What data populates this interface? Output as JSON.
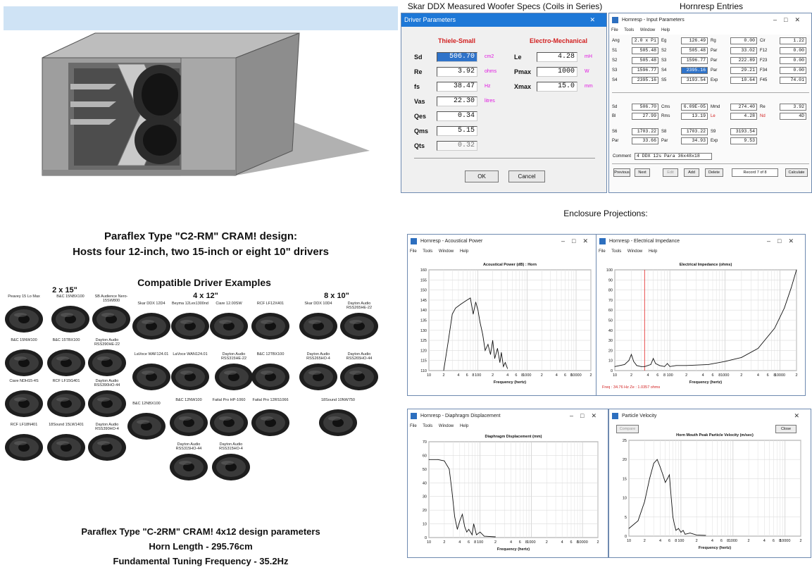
{
  "catalog": {
    "caption_line1": "Paraflex Type \"C2-RM\" CRAM! design:",
    "caption_line2": "Hosts four 12-inch, two 15-inch or eight 10\" drivers",
    "drivers_title": "Compatible Driver Examples",
    "groups": {
      "g15": "2 x 15\"",
      "g12": "4 x 12\"",
      "g10": "8 x 10\""
    },
    "drivers": [
      "Peavey 15 Lo Max",
      "B&C 15NBX100",
      "SB Audience Nero-15SW800",
      "B&C 15NW100",
      "B&C 15TBX100",
      "Dayton Audio RSS390HE-22",
      "Ciare NDH15-4S",
      "RCF LF15G401",
      "Dayton Audio RSS390HO-44",
      "RCF LF18N401",
      "18Sound 15LW1401",
      "Dayton Audio RSS390HO-4",
      "Skar DDX 12D4",
      "Beyma 12Lex1300nd",
      "Ciare 12.00SW",
      "RCF LF12X401",
      "LaVoce WAF124.01",
      "LaVoce WAN124.01",
      "Dayton Audio RSS315HE-22",
      "B&C 12TBX100",
      "B&C 12NBX100",
      "B&C 12NW100",
      "Faital Pro HP-1060",
      "Faital Pro 12RS1066",
      "Dayton Audio RSS315HO-44",
      "Dayton Audio RSS315HO-4",
      "Skar DDX 10D4",
      "Dayton Audio RSS265HE-22",
      "Dayton Audio RSS265HO-4",
      "Dayton Audio RSS265HO-44",
      "18Sound 10NW750"
    ],
    "params_line1": "Paraflex Type \"C-2RM\" CRAM! 4x12 design parameters",
    "params_line2": "Horn Length - 295.76cm",
    "params_line3": "Fundamental Tuning Frequency - 35.2Hz"
  },
  "driver_dialog": {
    "heading": "Skar DDX Measured Woofer Specs (Coils in Series)",
    "title": "Driver Parameters",
    "section_ts": "Thiele-Small",
    "section_em": "Electro-Mechanical",
    "ts": [
      {
        "label": "Sd",
        "value": "506.70",
        "unit": "cm2"
      },
      {
        "label": "Re",
        "value": "3.92",
        "unit": "ohms"
      },
      {
        "label": "fs",
        "value": "38.47",
        "unit": "Hz"
      },
      {
        "label": "Vas",
        "value": "22.30",
        "unit": "litres"
      },
      {
        "label": "Qes",
        "value": "0.34",
        "unit": ""
      },
      {
        "label": "Qms",
        "value": "5.15",
        "unit": ""
      },
      {
        "label": "Qts",
        "value": "0.32",
        "unit": ""
      }
    ],
    "em": [
      {
        "label": "Le",
        "value": "4.28",
        "unit": "mH"
      },
      {
        "label": "Pmax",
        "value": "1000",
        "unit": "W"
      },
      {
        "label": "Xmax",
        "value": "15.0",
        "unit": "mm"
      }
    ],
    "ok": "OK",
    "cancel": "Cancel"
  },
  "hornresp": {
    "heading": "Hornresp Entries",
    "title": "Hornresp - Input Parameters",
    "menu": [
      "File",
      "Tools",
      "Window",
      "Help"
    ],
    "rows1": [
      [
        [
          "Ang",
          "2.0 x Pi"
        ],
        [
          "Eg",
          "126.49"
        ],
        [
          "Rg",
          "0.00"
        ],
        [
          "Cir",
          "1.22"
        ]
      ],
      [
        [
          "S1",
          "505.48"
        ],
        [
          "S2",
          "505.48"
        ],
        [
          "Par",
          "33.02"
        ],
        [
          "F12",
          "0.00"
        ]
      ],
      [
        [
          "S2",
          "505.48"
        ],
        [
          "S3",
          "1596.77"
        ],
        [
          "Par",
          "222.89"
        ],
        [
          "F23",
          "0.00"
        ]
      ],
      [
        [
          "S3",
          "1596.77"
        ],
        [
          "S4",
          "2395.16"
        ],
        [
          "Par",
          "29.21"
        ],
        [
          "F34",
          "0.00"
        ]
      ],
      [
        [
          "S4",
          "2395.16"
        ],
        [
          "S5",
          "3193.54"
        ],
        [
          "Exp",
          "10.64"
        ],
        [
          "F45",
          "74.01"
        ]
      ]
    ],
    "rows2": [
      [
        [
          "Sd",
          "506.70"
        ],
        [
          "Cms",
          "6.09E-05"
        ],
        [
          "Mmd",
          "274.40"
        ],
        [
          "Re",
          "3.92"
        ]
      ],
      [
        [
          "Bl",
          "27.99"
        ],
        [
          "Rms",
          "13.19"
        ],
        [
          "Le",
          "4.28"
        ],
        [
          "Nd",
          "4D"
        ]
      ],
      [
        [
          "S6",
          "1703.22"
        ],
        [
          "S8",
          "1703.22"
        ],
        [
          "S9",
          "3193.54"
        ]
      ],
      [
        [
          "Par",
          "33.66"
        ],
        [
          "Par",
          "34.93"
        ],
        [
          "Exp",
          "9.53"
        ]
      ]
    ],
    "comment_label": "Comment",
    "comment": "4 DDX 12s Para 36x48x18",
    "buttons": [
      "Previous",
      "Next",
      "Edit",
      "Add",
      "Delete",
      "Record 7 of 8",
      "Calculate"
    ]
  },
  "projections": {
    "heading": "Enclosure Projections:",
    "power": {
      "window": "Hornresp - Acoustical Power",
      "title": "Acoustical Power (dB) : Horn",
      "xlabel": "Frequency (hertz)"
    },
    "impedance": {
      "window": "Hornresp - Electrical Impedance",
      "title": "Electrical Impedance (ohms)",
      "xlabel": "Frequency (hertz)",
      "readout": "Freq : 34.76 Hz   Ze : 1.0357 ohms",
      "marker_hz": 34.76
    },
    "displacement": {
      "window": "Hornresp - Diaphragm Displacement",
      "title": "Diaphragm Displacement (mm)",
      "xlabel": "Frequency (hertz)"
    },
    "velocity": {
      "window": "Particle Velocity",
      "title": "Horn Mouth Peak Particle Velocity (m/sec)",
      "xlabel": "Frequency (hertz)",
      "compare": "Compare",
      "close": "Close"
    },
    "menu": [
      "File",
      "Tools",
      "Window",
      "Help"
    ]
  },
  "chart_data": [
    {
      "type": "line",
      "title": "Acoustical Power (dB) : Horn",
      "xlabel": "Frequency (hertz)",
      "xscale": "log",
      "xlim": [
        10,
        20000
      ],
      "ylim": [
        110,
        160
      ],
      "yticks": [
        110,
        115,
        120,
        125,
        130,
        135,
        140,
        145,
        150,
        155,
        160
      ],
      "xticks": [
        "10",
        "2",
        "4",
        "6",
        "8",
        "100",
        "2",
        "4",
        "6",
        "8",
        "1000",
        "2",
        "4",
        "6",
        "8",
        "10000",
        "2"
      ],
      "x": [
        20,
        25,
        30,
        35,
        45,
        60,
        70,
        80,
        90,
        100,
        110,
        125,
        140,
        160,
        180,
        200,
        220,
        250,
        280,
        300,
        330,
        360,
        400
      ],
      "y": [
        110,
        125,
        138,
        141,
        143,
        145,
        146,
        138,
        144,
        140,
        134,
        128,
        120,
        123,
        118,
        125,
        116,
        121,
        114,
        119,
        112,
        114,
        111
      ]
    },
    {
      "type": "line",
      "title": "Electrical Impedance (ohms)",
      "xlabel": "Frequency (hertz)",
      "xscale": "log",
      "xlim": [
        10,
        20000
      ],
      "ylim": [
        0,
        100
      ],
      "yticks": [
        0,
        10,
        20,
        30,
        40,
        50,
        60,
        70,
        80,
        90,
        100
      ],
      "xticks": [
        "10",
        "2",
        "4",
        "6",
        "8",
        "100",
        "2",
        "4",
        "6",
        "8",
        "1000",
        "2",
        "4",
        "6",
        "8",
        "10000",
        "2"
      ],
      "x": [
        10,
        15,
        18,
        20,
        22,
        25,
        30,
        35,
        45,
        50,
        55,
        65,
        80,
        90,
        100,
        130,
        200,
        500,
        1000,
        2000,
        4000,
        8000,
        12000,
        16000,
        20000
      ],
      "y": [
        4,
        6,
        10,
        16,
        9,
        5,
        4,
        4,
        6,
        12,
        7,
        5,
        4,
        7,
        4,
        5,
        5,
        6,
        9,
        13,
        22,
        42,
        62,
        82,
        100
      ]
    },
    {
      "type": "line",
      "title": "Diaphragm Displacement (mm)",
      "xlabel": "Frequency (hertz)",
      "xscale": "log",
      "xlim": [
        10,
        20000
      ],
      "ylim": [
        0,
        70
      ],
      "yticks": [
        0,
        10,
        20,
        30,
        40,
        50,
        60,
        70
      ],
      "xticks": [
        "10",
        "2",
        "4",
        "6",
        "8",
        "100",
        "2",
        "4",
        "6",
        "8",
        "1000",
        "2",
        "4",
        "6",
        "8",
        "10000",
        "2"
      ],
      "x": [
        10,
        15,
        20,
        25,
        28,
        32,
        36,
        40,
        45,
        50,
        55,
        60,
        70,
        75,
        85,
        100,
        120,
        200
      ],
      "y": [
        57,
        57,
        56,
        50,
        35,
        15,
        6,
        12,
        17,
        8,
        4,
        6,
        2,
        10,
        2,
        4,
        1,
        0.5
      ]
    },
    {
      "type": "line",
      "title": "Horn Mouth Peak Particle Velocity (m/sec)",
      "xlabel": "Frequency (hertz)",
      "xscale": "log",
      "xlim": [
        10,
        20000
      ],
      "ylim": [
        0,
        25
      ],
      "yticks": [
        0,
        5,
        10,
        15,
        20,
        25
      ],
      "xticks": [
        "10",
        "2",
        "4",
        "6",
        "8",
        "100",
        "2",
        "4",
        "6",
        "8",
        "1000",
        "2",
        "4",
        "6",
        "8",
        "10000",
        "2"
      ],
      "x": [
        10,
        15,
        20,
        25,
        30,
        35,
        40,
        45,
        50,
        55,
        60,
        65,
        70,
        75,
        80,
        90,
        100,
        110,
        120,
        150,
        200,
        300
      ],
      "y": [
        2,
        4,
        9,
        15,
        19,
        20,
        18,
        16,
        14,
        15,
        16,
        10,
        5,
        3,
        1.5,
        2,
        1,
        1.5,
        0.5,
        0.8,
        0.3,
        0.2
      ]
    }
  ]
}
